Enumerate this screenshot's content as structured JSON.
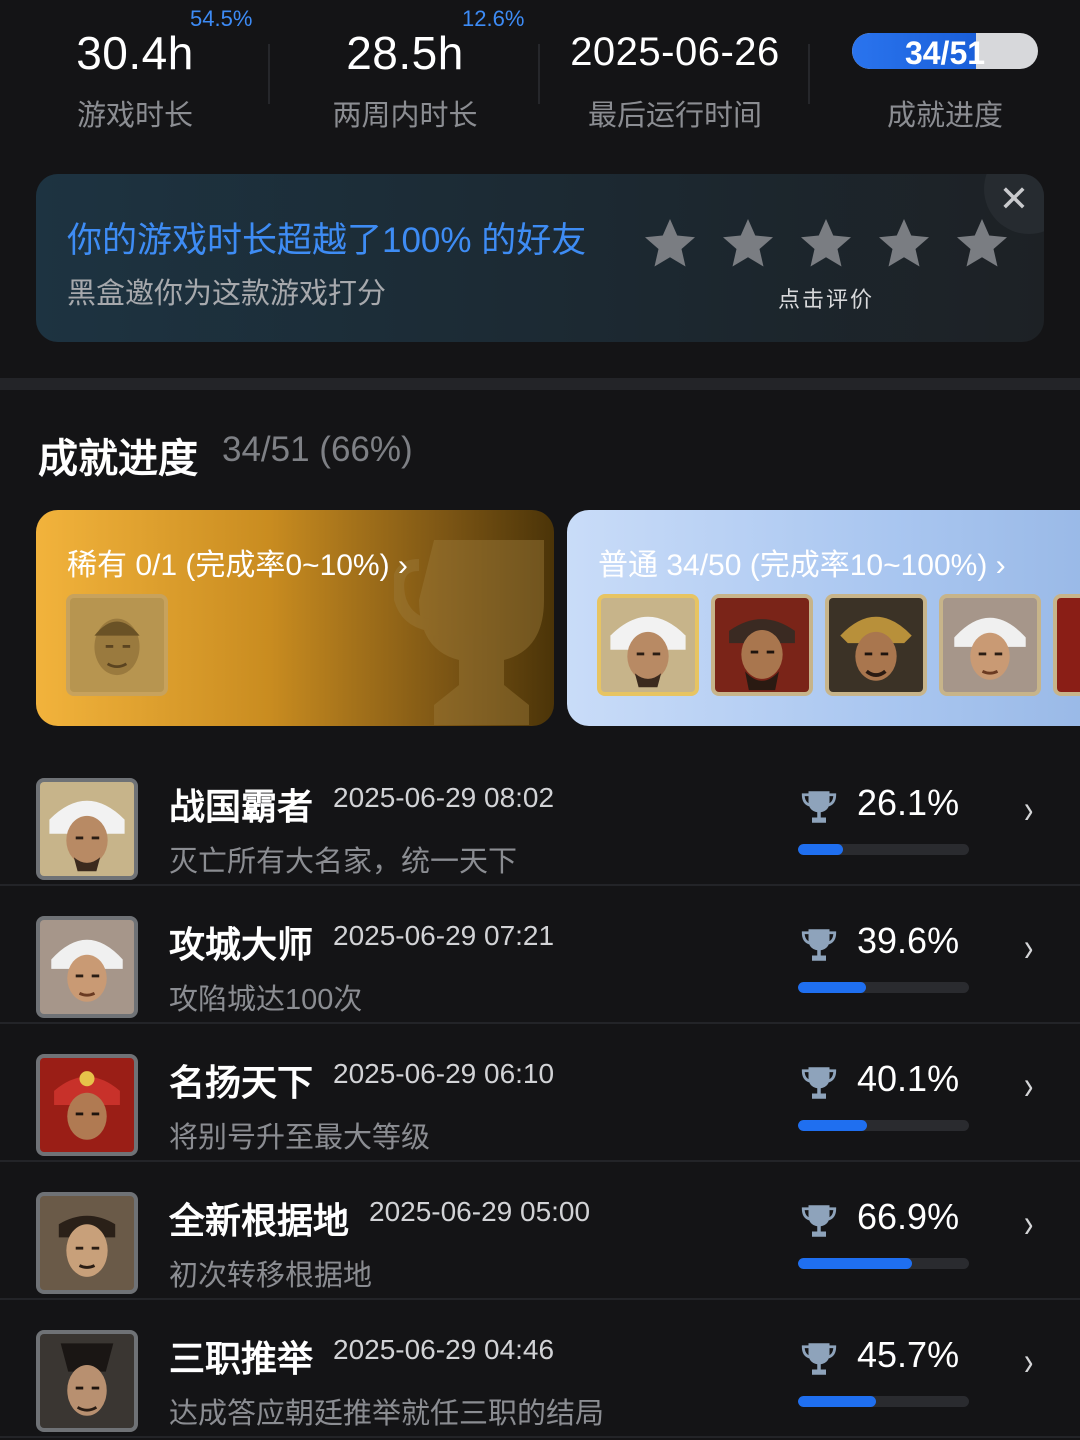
{
  "stats": {
    "play_time": {
      "value": "30.4h",
      "percent": "54.5%",
      "label": "游戏时长"
    },
    "two_week": {
      "value": "28.5h",
      "percent": "12.6%",
      "label": "两周内时长"
    },
    "last_run": {
      "value": "2025-06-26",
      "label": "最后运行时间"
    },
    "achievement": {
      "value": "34/51",
      "label": "成就进度",
      "progress": 0.667
    }
  },
  "rate_card": {
    "title": "你的游戏时长超越了100% 的好友",
    "subtitle": "黑盒邀你为这款游戏打分",
    "hint": "点击评价",
    "stars": 5,
    "close_icon": "close-icon"
  },
  "achievements": {
    "title": "成就进度",
    "count": "34/51 (66%)",
    "rare": {
      "label": "稀有 0/1 (完成率0~10%) ›"
    },
    "common": {
      "label": "普通 34/50 (完成率10~100%) ›"
    }
  },
  "list": [
    {
      "name": "战国霸者",
      "date": "2025-06-29 08:02",
      "desc": "灭亡所有大名家，统一天下",
      "pct": "26.1%",
      "progress": 0.261
    },
    {
      "name": "攻城大师",
      "date": "2025-06-29 07:21",
      "desc": "攻陷城达100次",
      "pct": "39.6%",
      "progress": 0.396
    },
    {
      "name": "名扬天下",
      "date": "2025-06-29 06:10",
      "desc": "将别号升至最大等级",
      "pct": "40.1%",
      "progress": 0.401
    },
    {
      "name": "全新根据地",
      "date": "2025-06-29 05:00",
      "desc": "初次转移根据地",
      "pct": "66.9%",
      "progress": 0.669
    },
    {
      "name": "三职推举",
      "date": "2025-06-29 04:46",
      "desc": "达成答应朝廷推举就任三职的结局",
      "pct": "45.7%",
      "progress": 0.457
    }
  ],
  "colors": {
    "accent": "#3d8bf5",
    "bar": "#1f6ff0",
    "bg": "#141416"
  }
}
